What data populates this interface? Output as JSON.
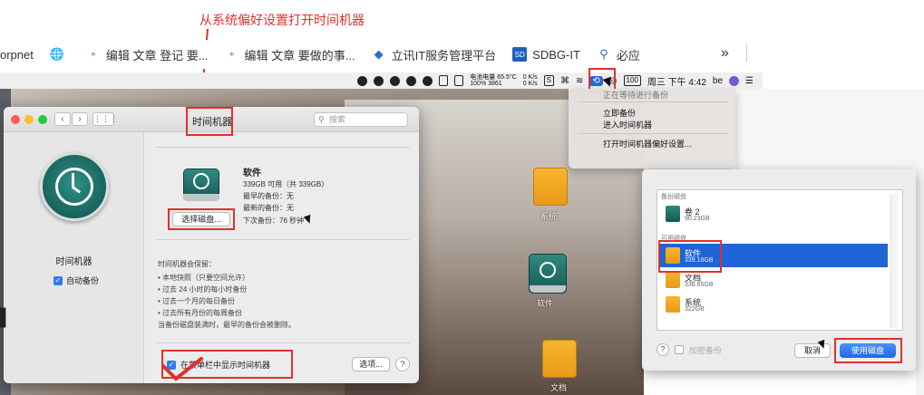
{
  "annotation": {
    "title": "从系统偏好设置打开时间机器"
  },
  "bookmarks": [
    {
      "label": "orpnet",
      "icon": ""
    },
    {
      "label": "",
      "icon": "globe-icon"
    },
    {
      "label": "编辑 文章 登记 要...",
      "icon": "jre-icon"
    },
    {
      "label": "编辑 文章 要做的事...",
      "icon": "jre-icon"
    },
    {
      "label": "立讯IT服务管理平台",
      "icon": "diamond-icon"
    },
    {
      "label": "SDBG-IT",
      "icon": "sd-icon"
    },
    {
      "label": "必应",
      "icon": "search-icon"
    }
  ],
  "menubar": {
    "stats_top": "电池电量 65.5°C",
    "stats_bottom": "100% 3861",
    "net_top": "0 K/s",
    "net_bottom": "0 K/s",
    "battery": "100",
    "clock": "周三 下午 4:42",
    "user": "be"
  },
  "tm_menu": {
    "items": [
      "正在等待进行备份",
      "立即备份",
      "进入时间机器",
      "打开时间机器偏好设置..."
    ]
  },
  "desktop": {
    "drives": [
      "系统",
      "软件",
      "文档"
    ]
  },
  "prefwin": {
    "title": "时间机器",
    "search_placeholder": "搜索",
    "app_name": "时间机器",
    "auto_backup": "自动备份",
    "disk_name": "软件",
    "disk_available": "339GB 可用（共 339GB）",
    "oldest_backup": "最早的备份：无",
    "latest_backup": "最新的备份：无",
    "next_backup": "下次备份：76 秒钟",
    "select_disk_button": "选择磁盘...",
    "keep_title": "时间机器会保留：",
    "keep_items": [
      "• 本地快照（只要空间允许）",
      "• 过去 24 小时的每小时备份",
      "• 过去一个月的每日备份",
      "• 过去所有月份的每周备份"
    ],
    "keep_note": "当备份磁盘装满时，最早的备份会被删除。",
    "show_in_menubar": "在菜单栏中显示时间机器",
    "options_button": "选项...",
    "help": "?"
  },
  "dialog": {
    "backup_section": "备份磁盘",
    "backup_disks": [
      {
        "name": "卷 2",
        "size": "90.23GB"
      }
    ],
    "available_section": "可用磁盘",
    "available_disks": [
      {
        "name": "软件",
        "size": "339.18GB"
      },
      {
        "name": "文档",
        "size": "338.65GB"
      },
      {
        "name": "系统",
        "size": "322GB"
      }
    ],
    "encrypt_label": "加密备份",
    "help": "?",
    "cancel_button": "取消",
    "use_disk_button": "使用磁盘"
  },
  "colors": {
    "annotation": "#e0312b",
    "accent": "#1f64d6",
    "tm_green": "#1b6a64",
    "drive_orange": "#f0a623"
  }
}
